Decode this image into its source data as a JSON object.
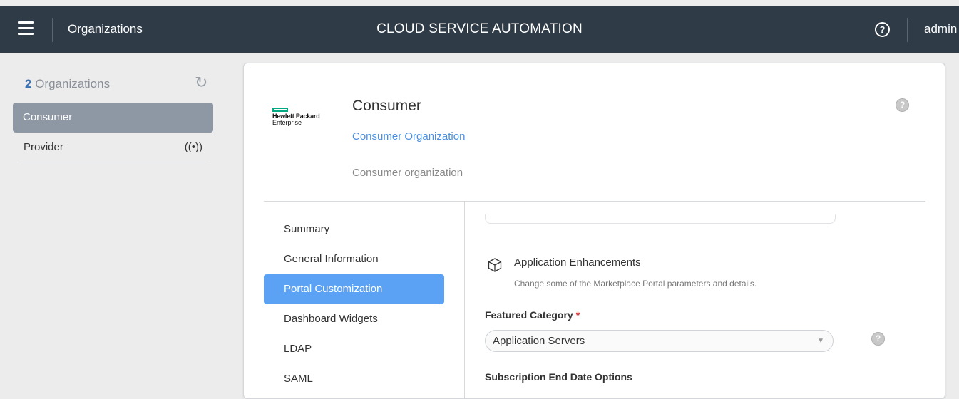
{
  "topbar": {
    "section": "Organizations",
    "title": "CLOUD SERVICE AUTOMATION",
    "help_glyph": "?",
    "user": "admin"
  },
  "sidebar": {
    "count": "2",
    "count_label": "Organizations",
    "refresh_glyph": "↻",
    "items": [
      {
        "label": "Consumer",
        "selected": true
      },
      {
        "label": "Provider",
        "icon": "broadcast-icon",
        "icon_glyph": "((•))"
      }
    ]
  },
  "org": {
    "logo_line1": "Hewlett Packard",
    "logo_line2": "Enterprise",
    "name": "Consumer",
    "type": "Consumer Organization",
    "description": "Consumer organization",
    "help_glyph": "?"
  },
  "nav": [
    {
      "label": "Summary"
    },
    {
      "label": "General Information"
    },
    {
      "label": "Portal Customization",
      "active": true
    },
    {
      "label": "Dashboard Widgets"
    },
    {
      "label": "LDAP"
    },
    {
      "label": "SAML"
    }
  ],
  "content": {
    "section_title": "Application Enhancements",
    "section_desc": "Change some of the Marketplace Portal parameters and details.",
    "featured_label": "Featured Category",
    "required_mark": "*",
    "featured_value": "Application Servers",
    "featured_help": "?",
    "subscription_label": "Subscription End Date Options"
  },
  "colors": {
    "topbar": "#2f3b47",
    "selected_org": "#8e98a5",
    "active_nav": "#5ba2f5",
    "link": "#4a90e2",
    "hpe_green": "#01a982"
  }
}
